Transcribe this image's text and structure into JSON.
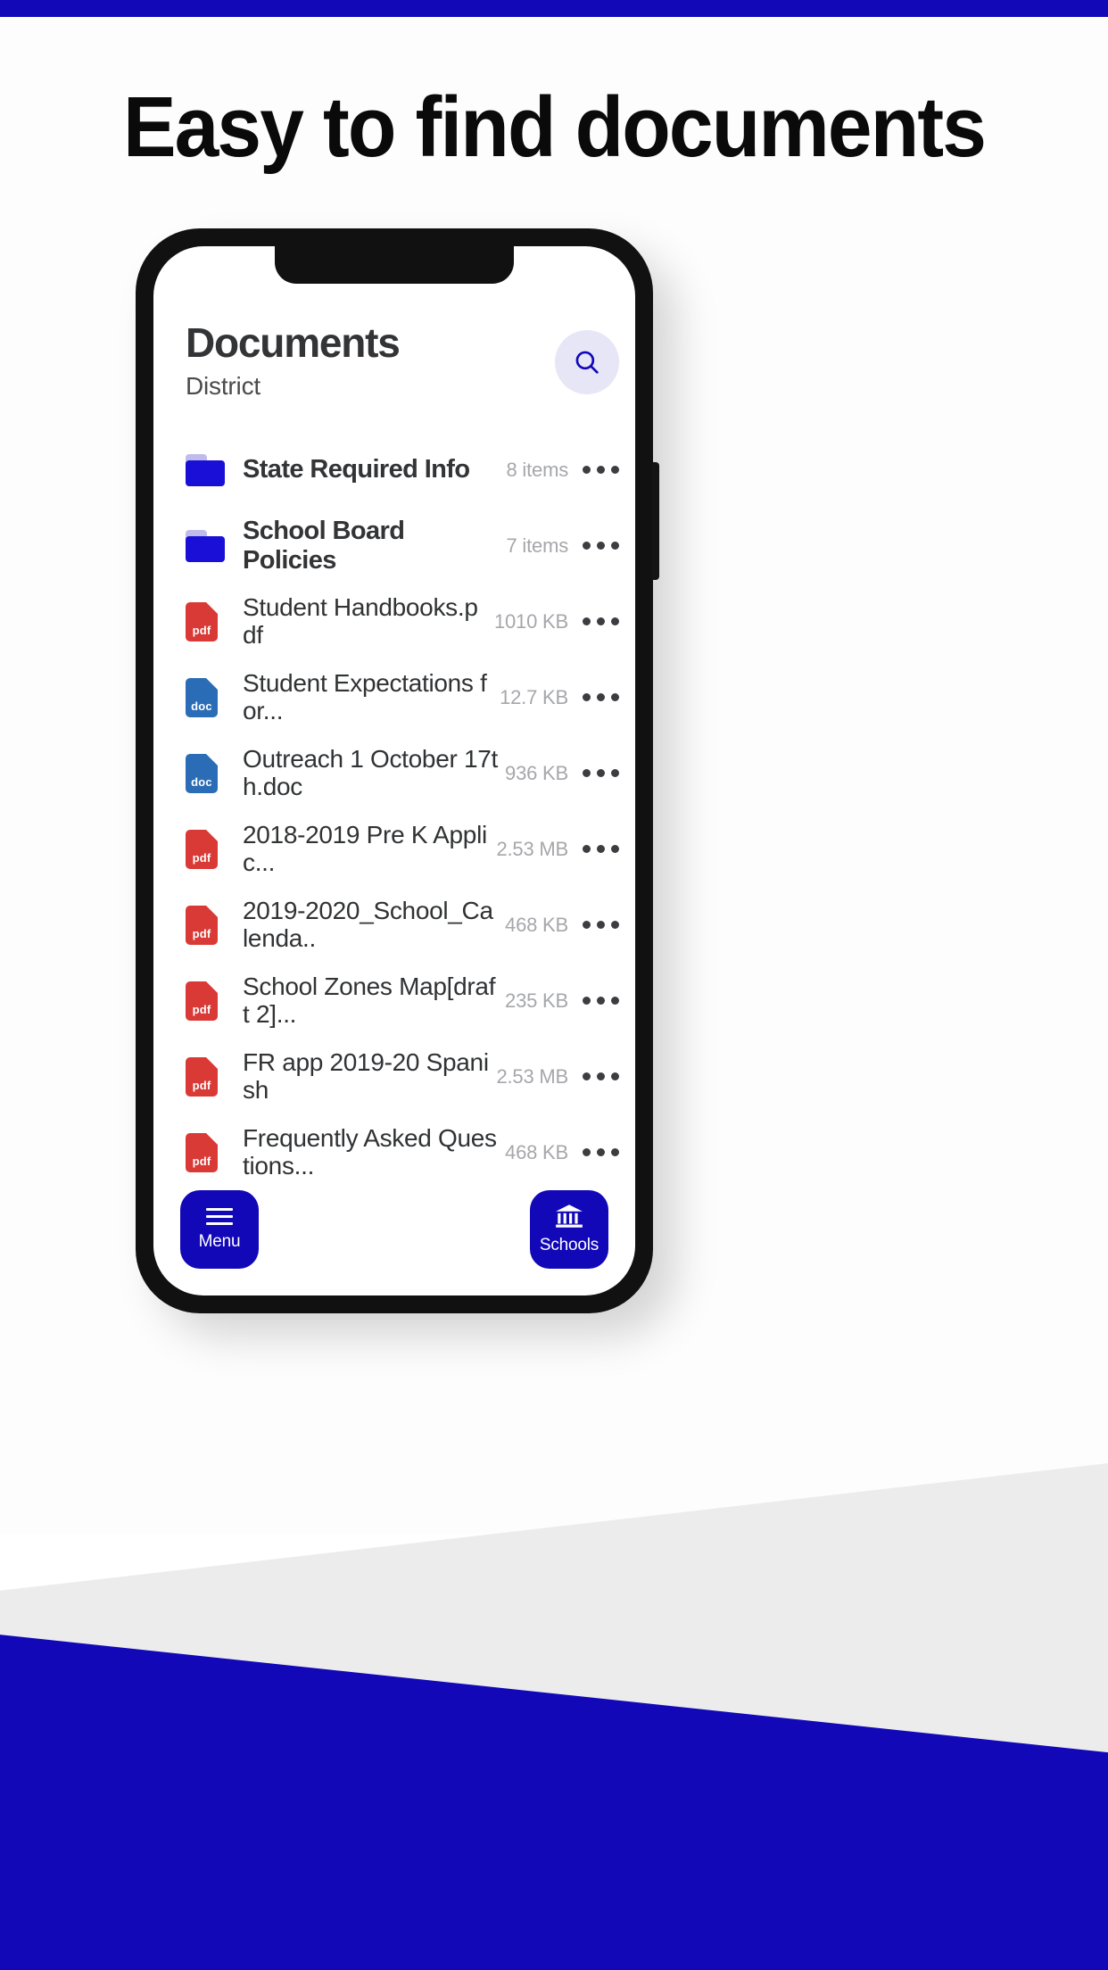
{
  "headline": "Easy to find documents",
  "colors": {
    "brand_blue": "#1208b8",
    "folder_blue": "#1a0fd6",
    "pdf_red": "#d93a36",
    "doc_blue": "#2a6cb6",
    "search_bg": "#e7e6f6",
    "meta_gray": "#a6a7ab"
  },
  "app": {
    "title": "Documents",
    "subtitle": "District",
    "search_icon": "search-icon"
  },
  "list": [
    {
      "type": "folder",
      "icon": "folder-icon",
      "name": "State Required Info",
      "meta": "8 items"
    },
    {
      "type": "folder",
      "icon": "folder-icon",
      "name": "School Board Policies",
      "meta": "7 items"
    },
    {
      "type": "pdf",
      "icon": "pdf-file-icon",
      "label": "pdf",
      "name": "Student Handbooks.pdf",
      "meta": "1010 KB"
    },
    {
      "type": "doc",
      "icon": "doc-file-icon",
      "label": "doc",
      "name": "Student Expectations for...",
      "meta": "12.7 KB"
    },
    {
      "type": "doc",
      "icon": "doc-file-icon",
      "label": "doc",
      "name": "Outreach 1 October 17th.doc",
      "meta": "936 KB"
    },
    {
      "type": "pdf",
      "icon": "pdf-file-icon",
      "label": "pdf",
      "name": "2018-2019 Pre K Applic...",
      "meta": "2.53 MB"
    },
    {
      "type": "pdf",
      "icon": "pdf-file-icon",
      "label": "pdf",
      "name": "2019-2020_School_Calenda..",
      "meta": "468 KB"
    },
    {
      "type": "pdf",
      "icon": "pdf-file-icon",
      "label": "pdf",
      "name": "School Zones Map[draft 2]...",
      "meta": "235 KB"
    },
    {
      "type": "pdf",
      "icon": "pdf-file-icon",
      "label": "pdf",
      "name": "FR app 2019-20 Spanish",
      "meta": "2.53 MB"
    },
    {
      "type": "pdf",
      "icon": "pdf-file-icon",
      "label": "pdf",
      "name": "Frequently Asked Questions...",
      "meta": "468 KB"
    }
  ],
  "bottom": {
    "menu_label": "Menu",
    "menu_icon": "hamburger-icon",
    "schools_label": "Schools",
    "schools_icon": "bank-columns-icon"
  }
}
